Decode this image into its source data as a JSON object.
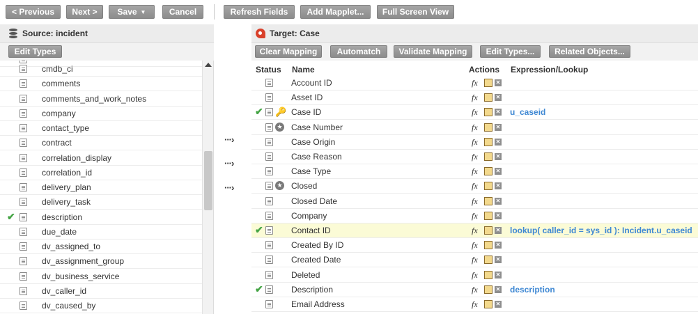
{
  "toolbar": {
    "prev": "< Previous",
    "next": "Next >",
    "save": "Save",
    "cancel": "Cancel",
    "refresh": "Refresh Fields",
    "add_mapplet": "Add Mapplet...",
    "full_screen": "Full Screen View"
  },
  "source": {
    "title": "Source: incident",
    "edit_types": "Edit Types",
    "fields": [
      {
        "name": "cmdb_ci",
        "mapped": false
      },
      {
        "name": "comments",
        "mapped": false
      },
      {
        "name": "comments_and_work_notes",
        "mapped": false
      },
      {
        "name": "company",
        "mapped": false
      },
      {
        "name": "contact_type",
        "mapped": false
      },
      {
        "name": "contract",
        "mapped": false
      },
      {
        "name": "correlation_display",
        "mapped": false
      },
      {
        "name": "correlation_id",
        "mapped": false
      },
      {
        "name": "delivery_plan",
        "mapped": false
      },
      {
        "name": "delivery_task",
        "mapped": false
      },
      {
        "name": "description",
        "mapped": true
      },
      {
        "name": "due_date",
        "mapped": false
      },
      {
        "name": "dv_assigned_to",
        "mapped": false
      },
      {
        "name": "dv_assignment_group",
        "mapped": false
      },
      {
        "name": "dv_business_service",
        "mapped": false
      },
      {
        "name": "dv_caller_id",
        "mapped": false
      },
      {
        "name": "dv_caused_by",
        "mapped": false
      }
    ]
  },
  "target": {
    "title": "Target: Case",
    "buttons": {
      "clear": "Clear Mapping",
      "automatch": "Automatch",
      "validate": "Validate Mapping",
      "edit_types": "Edit Types...",
      "related": "Related Objects..."
    },
    "columns": {
      "status": "Status",
      "name": "Name",
      "actions": "Actions",
      "expression": "Expression/Lookup"
    },
    "fx_label": "fx",
    "fields": [
      {
        "name": "Account ID",
        "mapped": false,
        "marker": "",
        "expr": ""
      },
      {
        "name": "Asset ID",
        "mapped": false,
        "marker": "",
        "expr": ""
      },
      {
        "name": "Case ID",
        "mapped": true,
        "marker": "key",
        "expr": "u_caseid"
      },
      {
        "name": "Case Number",
        "mapped": false,
        "marker": "star",
        "expr": ""
      },
      {
        "name": "Case Origin",
        "mapped": false,
        "marker": "",
        "expr": ""
      },
      {
        "name": "Case Reason",
        "mapped": false,
        "marker": "",
        "expr": ""
      },
      {
        "name": "Case Type",
        "mapped": false,
        "marker": "",
        "expr": ""
      },
      {
        "name": "Closed",
        "mapped": false,
        "marker": "star",
        "expr": ""
      },
      {
        "name": "Closed Date",
        "mapped": false,
        "marker": "",
        "expr": ""
      },
      {
        "name": "Company",
        "mapped": false,
        "marker": "",
        "expr": ""
      },
      {
        "name": "Contact ID",
        "mapped": true,
        "marker": "",
        "expr": "lookup( caller_id = sys_id ): Incident.u_caseid",
        "highlighted": true
      },
      {
        "name": "Created By ID",
        "mapped": false,
        "marker": "",
        "expr": ""
      },
      {
        "name": "Created Date",
        "mapped": false,
        "marker": "",
        "expr": ""
      },
      {
        "name": "Deleted",
        "mapped": false,
        "marker": "",
        "expr": ""
      },
      {
        "name": "Description",
        "mapped": true,
        "marker": "",
        "expr": "description"
      },
      {
        "name": "Email Address",
        "mapped": false,
        "marker": "",
        "expr": ""
      }
    ]
  },
  "icons": {
    "check": "checkmark-icon",
    "doc": "document-icon",
    "key": "key-icon",
    "star": "star-icon",
    "fx": "function-icon",
    "lookup": "lookup-icon",
    "delete": "delete-icon",
    "arrow": "dotted-arrow-icon",
    "database": "database-icon",
    "target": "target-app-icon"
  },
  "colors": {
    "button": "#999999",
    "check": "#44a444",
    "expression": "#3f88d3",
    "highlight_row": "#fbfbd6"
  }
}
